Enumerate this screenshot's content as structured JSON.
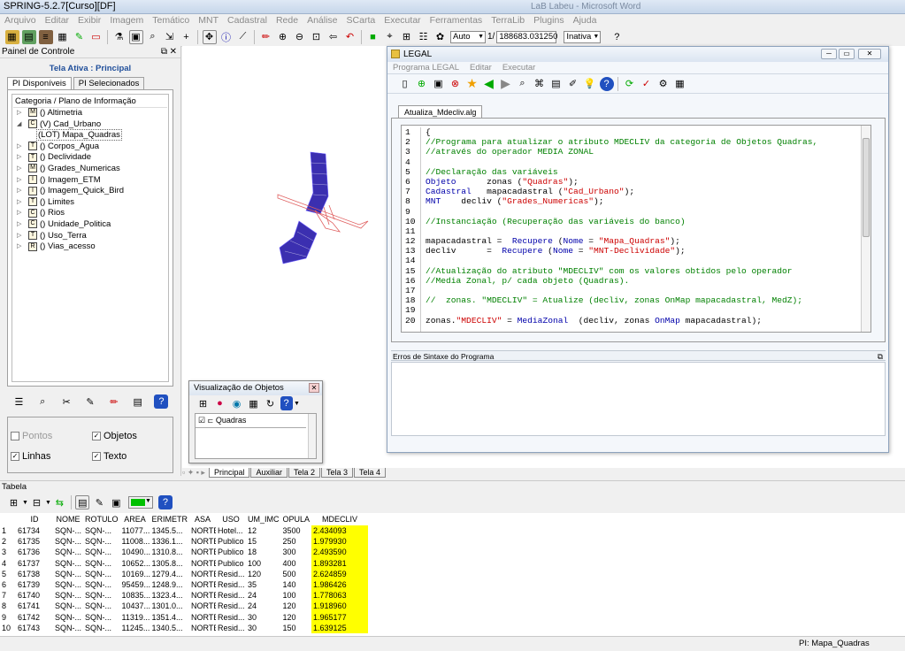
{
  "app": {
    "title": "SPRING-5.2.7[Curso][DF]",
    "title_right": "LaB Labeu - Microsoft Word"
  },
  "menu": [
    "Arquivo",
    "Editar",
    "Exibir",
    "Imagem",
    "Temático",
    "MNT",
    "Cadastral",
    "Rede",
    "Análise",
    "SCarta",
    "Executar",
    "Ferramentas",
    "TerraLib",
    "Plugins",
    "Ajuda"
  ],
  "toolbar": {
    "zoom_mode": "Auto",
    "scale_prefix": "1/",
    "scale_value": "188683.031250",
    "state": "Inativa"
  },
  "control_panel": {
    "title": "Painel de Controle",
    "active_screen": "Tela Ativa : Principal",
    "tabs": [
      "PI Disponíveis",
      "PI Selecionados"
    ],
    "tree_header": "Categoria / Plano de Informação",
    "tree": [
      {
        "icon": "M",
        "label": "() Altimetria",
        "exp": "▷"
      },
      {
        "icon": "C",
        "label": "(V) Cad_Urbano",
        "exp": "◢"
      },
      {
        "icon": "",
        "label": "(LOT) Mapa_Quadras",
        "exp": "",
        "selected": true
      },
      {
        "icon": "T",
        "label": "() Corpos_Agua",
        "exp": "▷"
      },
      {
        "icon": "T",
        "label": "() Declividade",
        "exp": "▷"
      },
      {
        "icon": "M",
        "label": "() Grades_Numericas",
        "exp": "▷"
      },
      {
        "icon": "I",
        "label": "() Imagem_ETM",
        "exp": "▷"
      },
      {
        "icon": "I",
        "label": "() Imagem_Quick_Bird",
        "exp": "▷"
      },
      {
        "icon": "T",
        "label": "() Limites",
        "exp": "▷"
      },
      {
        "icon": "C",
        "label": "() Rios",
        "exp": "▷"
      },
      {
        "icon": "C",
        "label": "() Unidade_Politica",
        "exp": "▷"
      },
      {
        "icon": "T",
        "label": "() Uso_Terra",
        "exp": "▷"
      },
      {
        "icon": "R",
        "label": "() Vias_acesso",
        "exp": "▷"
      }
    ],
    "options": {
      "pontos": "Pontos",
      "objetos": "Objetos",
      "linhas": "Linhas",
      "texto": "Texto"
    }
  },
  "legal": {
    "title": "LEGAL",
    "menu": [
      "Programa LEGAL",
      "Editar",
      "Executar"
    ],
    "file_tab": "Atualiza_Mdecliv.alg",
    "errors_title": "Erros de Sintaxe do Programa",
    "code": [
      [
        [
          "t",
          "{"
        ]
      ],
      [
        [
          "c",
          "//Programa para atualizar o atributo MDECLIV da categoria de Objetos Quadras,"
        ]
      ],
      [
        [
          "c",
          "//através do operador MEDIA ZONAL"
        ]
      ],
      [],
      [
        [
          "c",
          "//Declaração das variáveis"
        ]
      ],
      [
        [
          "k",
          "Objeto"
        ],
        [
          "t",
          "      zonas ("
        ],
        [
          "s",
          "\"Quadras\""
        ],
        [
          "t",
          ");"
        ]
      ],
      [
        [
          "k",
          "Cadastral"
        ],
        [
          "t",
          "   mapacadastral ("
        ],
        [
          "s",
          "\"Cad_Urbano\""
        ],
        [
          "t",
          ");"
        ]
      ],
      [
        [
          "k",
          "MNT"
        ],
        [
          "t",
          "    decliv ("
        ],
        [
          "s",
          "\"Grades_Numericas\""
        ],
        [
          "t",
          ");"
        ]
      ],
      [],
      [
        [
          "c",
          "//Instanciação (Recuperação das variáveis do banco)"
        ]
      ],
      [],
      [
        [
          "t",
          "mapacadastral =  "
        ],
        [
          "f",
          "Recupere"
        ],
        [
          "t",
          " ("
        ],
        [
          "f",
          "Nome"
        ],
        [
          "t",
          " = "
        ],
        [
          "s",
          "\"Mapa_Quadras\""
        ],
        [
          "t",
          ");"
        ]
      ],
      [
        [
          "t",
          "decliv      =  "
        ],
        [
          "f",
          "Recupere"
        ],
        [
          "t",
          " ("
        ],
        [
          "f",
          "Nome"
        ],
        [
          "t",
          " = "
        ],
        [
          "s",
          "\"MNT-Declividade\""
        ],
        [
          "t",
          ");"
        ]
      ],
      [],
      [
        [
          "c",
          "//Atualização do atributo \"MDECLIV\" com os valores obtidos pelo operador"
        ]
      ],
      [
        [
          "c",
          "//Media Zonal, p/ cada objeto (Quadras)."
        ]
      ],
      [],
      [
        [
          "c",
          "//  zonas. \"MDECLIV\" = Atualize (decliv, zonas OnMap mapacadastral, MedZ);"
        ]
      ],
      [],
      [
        [
          "t",
          "zonas."
        ],
        [
          "s",
          "\"MDECLIV\""
        ],
        [
          "t",
          " = "
        ],
        [
          "f",
          "MediaZonal"
        ],
        [
          "t",
          "  (decliv, zonas "
        ],
        [
          "f",
          "OnMap"
        ],
        [
          "t",
          " mapacadastral);"
        ]
      ]
    ]
  },
  "object_view": {
    "title": "Visualização de Objetos",
    "item": "Quadras"
  },
  "screens": [
    "Principal",
    "Auxiliar",
    "Tela 2",
    "Tela 3",
    "Tela 4"
  ],
  "table": {
    "title": "Tabela",
    "headers": [
      "",
      "ID",
      "NOME",
      "ROTULO",
      "AREA",
      "ERIMETR",
      "ASA",
      "USO",
      "UM_IMC",
      "OPULA",
      "MDECLIV"
    ],
    "rows": [
      [
        "1",
        "61734",
        "SQN-...",
        "SQN-...",
        "11077...",
        "1345.5...",
        "NORTE",
        "Hotel...",
        "12",
        "3500",
        "2.434093"
      ],
      [
        "2",
        "61735",
        "SQN-...",
        "SQN-...",
        "11008...",
        "1336.1...",
        "NORTE",
        "Publico",
        "15",
        "250",
        "1.979930"
      ],
      [
        "3",
        "61736",
        "SQN-...",
        "SQN-...",
        "10490...",
        "1310.8...",
        "NORTE",
        "Publico",
        "18",
        "300",
        "2.493590"
      ],
      [
        "4",
        "61737",
        "SQN-...",
        "SQN-...",
        "10652...",
        "1305.8...",
        "NORTE",
        "Publico",
        "100",
        "400",
        "1.893281"
      ],
      [
        "5",
        "61738",
        "SQN-...",
        "SQN-...",
        "10169...",
        "1279.4...",
        "NORTE",
        "Resid...",
        "120",
        "500",
        "2.624859"
      ],
      [
        "6",
        "61739",
        "SQN-...",
        "SQN-...",
        "95459...",
        "1248.9...",
        "NORTE",
        "Resid...",
        "35",
        "140",
        "1.986426"
      ],
      [
        "7",
        "61740",
        "SQN-...",
        "SQN-...",
        "10835...",
        "1323.4...",
        "NORTE",
        "Resid...",
        "24",
        "100",
        "1.778063"
      ],
      [
        "8",
        "61741",
        "SQN-...",
        "SQN-...",
        "10437...",
        "1301.0...",
        "NORTE",
        "Resid...",
        "24",
        "120",
        "1.918960"
      ],
      [
        "9",
        "61742",
        "SQN-...",
        "SQN-...",
        "11319...",
        "1351.4...",
        "NORTE",
        "Resid...",
        "30",
        "120",
        "1.965177"
      ],
      [
        "10",
        "61743",
        "SQN-...",
        "SQN-...",
        "11245...",
        "1340.5...",
        "NORTE",
        "Resid...",
        "30",
        "150",
        "1.639125"
      ]
    ]
  },
  "status": {
    "pi": "PI: Mapa_Quadras"
  },
  "colors": {
    "highlight": "#ffff00",
    "map_blocks": "#3b2fb0",
    "map_road": "#e06060"
  }
}
